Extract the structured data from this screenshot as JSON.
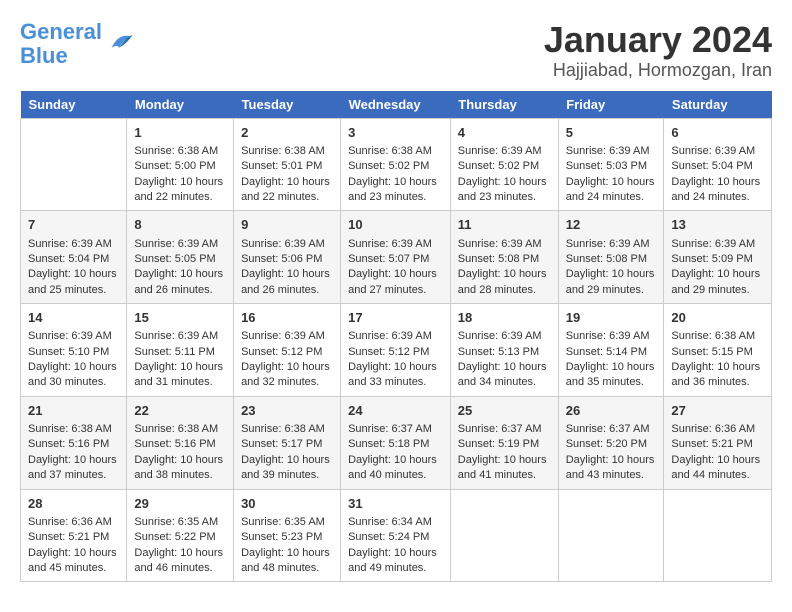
{
  "logo": {
    "line1": "General",
    "line2": "Blue"
  },
  "title": "January 2024",
  "subtitle": "Hajjiabad, Hormozgan, Iran",
  "days_of_week": [
    "Sunday",
    "Monday",
    "Tuesday",
    "Wednesday",
    "Thursday",
    "Friday",
    "Saturday"
  ],
  "weeks": [
    [
      {
        "day": "",
        "content": ""
      },
      {
        "day": "1",
        "content": "Sunrise: 6:38 AM\nSunset: 5:00 PM\nDaylight: 10 hours\nand 22 minutes."
      },
      {
        "day": "2",
        "content": "Sunrise: 6:38 AM\nSunset: 5:01 PM\nDaylight: 10 hours\nand 22 minutes."
      },
      {
        "day": "3",
        "content": "Sunrise: 6:38 AM\nSunset: 5:02 PM\nDaylight: 10 hours\nand 23 minutes."
      },
      {
        "day": "4",
        "content": "Sunrise: 6:39 AM\nSunset: 5:02 PM\nDaylight: 10 hours\nand 23 minutes."
      },
      {
        "day": "5",
        "content": "Sunrise: 6:39 AM\nSunset: 5:03 PM\nDaylight: 10 hours\nand 24 minutes."
      },
      {
        "day": "6",
        "content": "Sunrise: 6:39 AM\nSunset: 5:04 PM\nDaylight: 10 hours\nand 24 minutes."
      }
    ],
    [
      {
        "day": "7",
        "content": "Sunrise: 6:39 AM\nSunset: 5:04 PM\nDaylight: 10 hours\nand 25 minutes."
      },
      {
        "day": "8",
        "content": "Sunrise: 6:39 AM\nSunset: 5:05 PM\nDaylight: 10 hours\nand 26 minutes."
      },
      {
        "day": "9",
        "content": "Sunrise: 6:39 AM\nSunset: 5:06 PM\nDaylight: 10 hours\nand 26 minutes."
      },
      {
        "day": "10",
        "content": "Sunrise: 6:39 AM\nSunset: 5:07 PM\nDaylight: 10 hours\nand 27 minutes."
      },
      {
        "day": "11",
        "content": "Sunrise: 6:39 AM\nSunset: 5:08 PM\nDaylight: 10 hours\nand 28 minutes."
      },
      {
        "day": "12",
        "content": "Sunrise: 6:39 AM\nSunset: 5:08 PM\nDaylight: 10 hours\nand 29 minutes."
      },
      {
        "day": "13",
        "content": "Sunrise: 6:39 AM\nSunset: 5:09 PM\nDaylight: 10 hours\nand 29 minutes."
      }
    ],
    [
      {
        "day": "14",
        "content": "Sunrise: 6:39 AM\nSunset: 5:10 PM\nDaylight: 10 hours\nand 30 minutes."
      },
      {
        "day": "15",
        "content": "Sunrise: 6:39 AM\nSunset: 5:11 PM\nDaylight: 10 hours\nand 31 minutes."
      },
      {
        "day": "16",
        "content": "Sunrise: 6:39 AM\nSunset: 5:12 PM\nDaylight: 10 hours\nand 32 minutes."
      },
      {
        "day": "17",
        "content": "Sunrise: 6:39 AM\nSunset: 5:12 PM\nDaylight: 10 hours\nand 33 minutes."
      },
      {
        "day": "18",
        "content": "Sunrise: 6:39 AM\nSunset: 5:13 PM\nDaylight: 10 hours\nand 34 minutes."
      },
      {
        "day": "19",
        "content": "Sunrise: 6:39 AM\nSunset: 5:14 PM\nDaylight: 10 hours\nand 35 minutes."
      },
      {
        "day": "20",
        "content": "Sunrise: 6:38 AM\nSunset: 5:15 PM\nDaylight: 10 hours\nand 36 minutes."
      }
    ],
    [
      {
        "day": "21",
        "content": "Sunrise: 6:38 AM\nSunset: 5:16 PM\nDaylight: 10 hours\nand 37 minutes."
      },
      {
        "day": "22",
        "content": "Sunrise: 6:38 AM\nSunset: 5:16 PM\nDaylight: 10 hours\nand 38 minutes."
      },
      {
        "day": "23",
        "content": "Sunrise: 6:38 AM\nSunset: 5:17 PM\nDaylight: 10 hours\nand 39 minutes."
      },
      {
        "day": "24",
        "content": "Sunrise: 6:37 AM\nSunset: 5:18 PM\nDaylight: 10 hours\nand 40 minutes."
      },
      {
        "day": "25",
        "content": "Sunrise: 6:37 AM\nSunset: 5:19 PM\nDaylight: 10 hours\nand 41 minutes."
      },
      {
        "day": "26",
        "content": "Sunrise: 6:37 AM\nSunset: 5:20 PM\nDaylight: 10 hours\nand 43 minutes."
      },
      {
        "day": "27",
        "content": "Sunrise: 6:36 AM\nSunset: 5:21 PM\nDaylight: 10 hours\nand 44 minutes."
      }
    ],
    [
      {
        "day": "28",
        "content": "Sunrise: 6:36 AM\nSunset: 5:21 PM\nDaylight: 10 hours\nand 45 minutes."
      },
      {
        "day": "29",
        "content": "Sunrise: 6:35 AM\nSunset: 5:22 PM\nDaylight: 10 hours\nand 46 minutes."
      },
      {
        "day": "30",
        "content": "Sunrise: 6:35 AM\nSunset: 5:23 PM\nDaylight: 10 hours\nand 48 minutes."
      },
      {
        "day": "31",
        "content": "Sunrise: 6:34 AM\nSunset: 5:24 PM\nDaylight: 10 hours\nand 49 minutes."
      },
      {
        "day": "",
        "content": ""
      },
      {
        "day": "",
        "content": ""
      },
      {
        "day": "",
        "content": ""
      }
    ]
  ]
}
